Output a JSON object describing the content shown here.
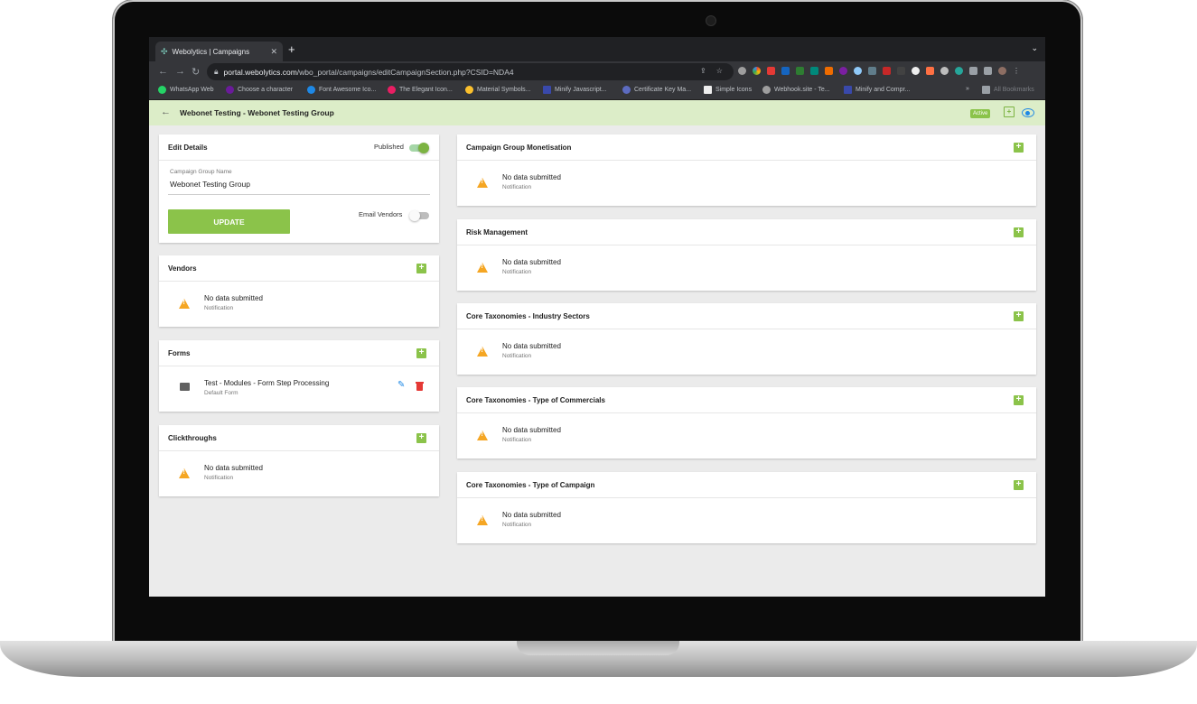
{
  "browser": {
    "tab_title": "Webolytics | Campaigns",
    "url_host": "portal.webolytics.com",
    "url_path": "/wbo_portal/campaigns/editCampaignSection.php?CSID=NDA4",
    "bookmarks": [
      {
        "label": "WhatsApp Web",
        "color": "#25d366"
      },
      {
        "label": "Choose a character",
        "color": "#6a1b9a"
      },
      {
        "label": "Font Awesome Ico...",
        "color": "#1e88e5"
      },
      {
        "label": "The Elegant Icon...",
        "color": "#e91e63"
      },
      {
        "label": "Material Symbols...",
        "color": "#fbc02d"
      },
      {
        "label": "Minify Javascript...",
        "color": "#3949ab"
      },
      {
        "label": "Certificate Key Ma...",
        "color": "#5c6bc0"
      },
      {
        "label": "Simple Icons",
        "color": "#eeeeee"
      },
      {
        "label": "Webhook.site - Te...",
        "color": "#9e9e9e"
      },
      {
        "label": "Minify and Compr...",
        "color": "#3949ab"
      }
    ],
    "all_bookmarks": "All Bookmarks"
  },
  "header": {
    "title": "Webonet Testing - Webonet Testing Group",
    "status": "Active"
  },
  "edit_details": {
    "title": "Edit Details",
    "published_label": "Published",
    "published": true,
    "name_label": "Campaign Group Name",
    "name_value": "Webonet Testing Group",
    "email_vendors_label": "Email Vendors",
    "email_vendors": false,
    "update_label": "UPDATE"
  },
  "vendors": {
    "title": "Vendors",
    "empty_text": "No data submitted",
    "empty_sub": "Notification"
  },
  "forms": {
    "title": "Forms",
    "items": [
      {
        "name": "Test - Modules - Form Step Processing",
        "sub": "Default Form"
      }
    ]
  },
  "clickthroughs": {
    "title": "Clickthroughs",
    "empty_text": "No data submitted",
    "empty_sub": "Notification"
  },
  "right_sections": [
    {
      "title": "Campaign Group Monetisation",
      "empty_text": "No data submitted",
      "empty_sub": "Notification"
    },
    {
      "title": "Risk Management",
      "empty_text": "No data submitted",
      "empty_sub": "Notification"
    },
    {
      "title": "Core Taxonomies - Industry Sectors",
      "empty_text": "No data submitted",
      "empty_sub": "Notification"
    },
    {
      "title": "Core Taxonomies - Type of Commercials",
      "empty_text": "No data submitted",
      "empty_sub": "Notification"
    },
    {
      "title": "Core Taxonomies - Type of Campaign",
      "empty_text": "No data submitted",
      "empty_sub": "Notification"
    }
  ],
  "colors": {
    "accent": "#8bc34a",
    "header_bg": "#dcedc8",
    "warning": "#f5a623",
    "edit": "#1e88e5",
    "delete": "#e53935"
  }
}
